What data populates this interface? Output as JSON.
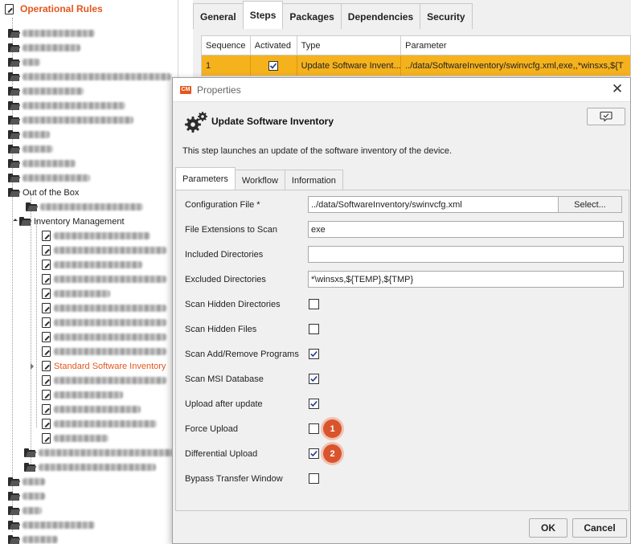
{
  "tree": {
    "root_label": "Operational Rules",
    "out_of_box_label": "Out of the Box",
    "inventory_label": "Inventory Management",
    "selected_label": "Standard Software Inventory"
  },
  "main_tabs": [
    "General",
    "Steps",
    "Packages",
    "Dependencies",
    "Security"
  ],
  "grid": {
    "columns": [
      "Sequence",
      "Activated",
      "Type",
      "Parameter"
    ],
    "row": {
      "sequence": "1",
      "type": "Update Software Invent...",
      "parameter": "../data/SoftwareInventory/swinvcfg.xml,exe,,*winsxs,${T"
    }
  },
  "dialog": {
    "logo_text": "CM",
    "title": "Properties",
    "heading": "Update Software Inventory",
    "description": "This step launches an update of the software inventory of the device.",
    "tabs": [
      "Parameters",
      "Workflow",
      "Information"
    ],
    "fields": {
      "config_label": "Configuration File *",
      "config_value": "../data/SoftwareInventory/swinvcfg.xml",
      "select_button": "Select...",
      "ext_label": "File Extensions to Scan",
      "ext_value": "exe",
      "inc_label": "Included Directories",
      "inc_value": "",
      "exc_label": "Excluded Directories",
      "exc_value": "*\\winsxs,${TEMP},${TMP}"
    },
    "checks": [
      {
        "label": "Scan Hidden Directories",
        "checked": false
      },
      {
        "label": "Scan Hidden Files",
        "checked": false
      },
      {
        "label": "Scan Add/Remove Programs",
        "checked": true
      },
      {
        "label": "Scan MSI Database",
        "checked": true
      },
      {
        "label": "Upload after update",
        "checked": true
      },
      {
        "label": "Force Upload",
        "checked": false,
        "badge": "1"
      },
      {
        "label": "Differential Upload",
        "checked": true,
        "badge": "2"
      },
      {
        "label": "Bypass Transfer Window",
        "checked": false
      }
    ],
    "ok_button": "OK",
    "cancel_button": "Cancel"
  },
  "colors": {
    "accent": "#e4561e",
    "selected_row": "#f5b21d",
    "badge": "#d9542c"
  }
}
